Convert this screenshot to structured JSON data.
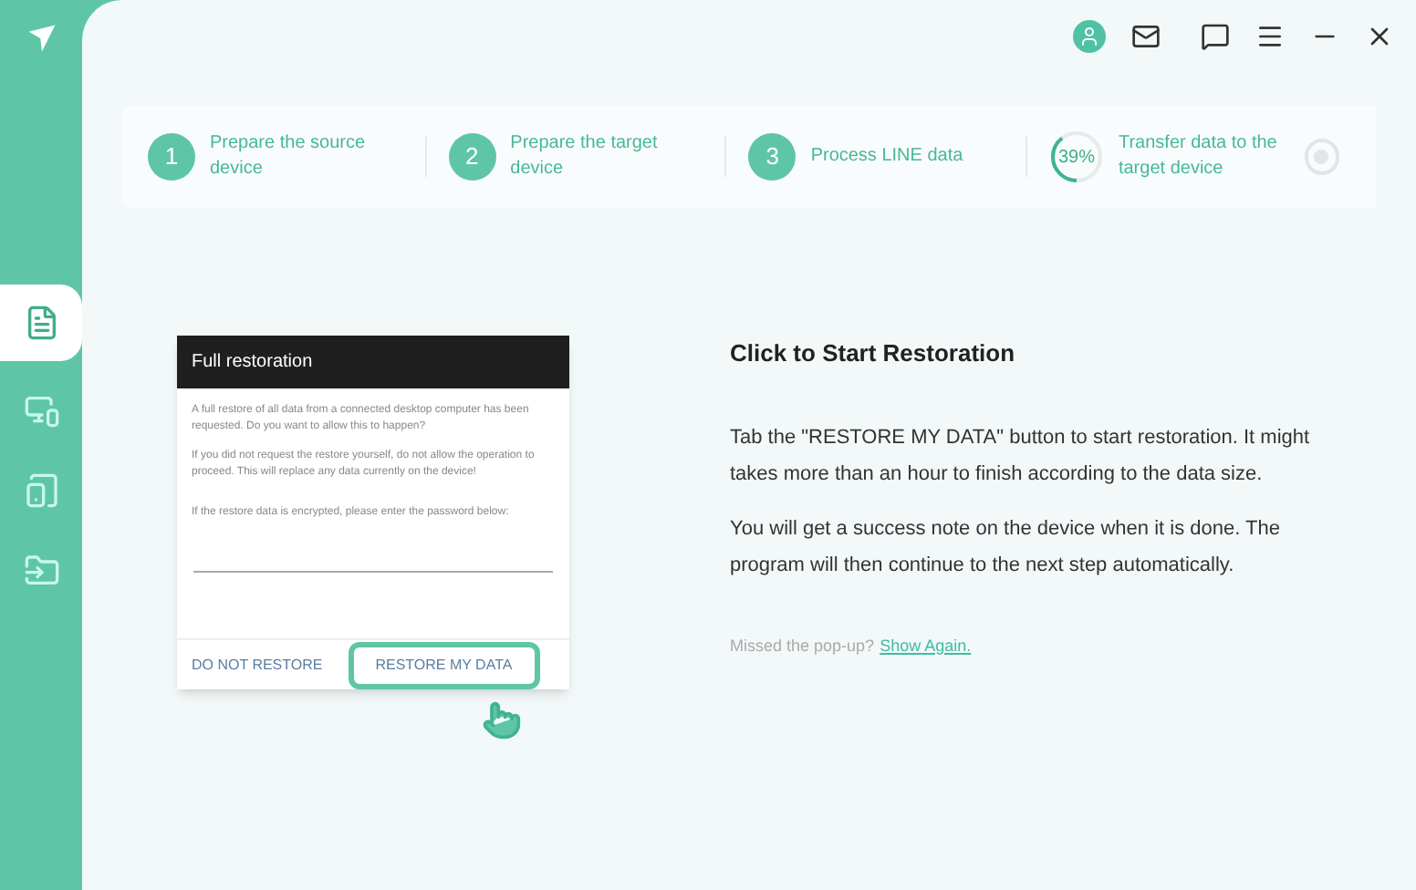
{
  "sidebar": {
    "items": [
      {
        "kind": "document",
        "selected": true
      },
      {
        "kind": "monitor",
        "selected": false
      },
      {
        "kind": "phone",
        "selected": false
      },
      {
        "kind": "folder",
        "selected": false
      }
    ]
  },
  "steps": [
    {
      "kind": "number",
      "number": "1",
      "label": "Prepare the source device"
    },
    {
      "kind": "number",
      "number": "2",
      "label": "Prepare the target device"
    },
    {
      "kind": "number",
      "number": "3",
      "label": "Process LINE data"
    },
    {
      "kind": "progress",
      "number": "39%",
      "label": "Transfer data to the target device"
    }
  ],
  "dialog": {
    "title": "Full restoration",
    "paragraphs": [
      "A full restore of all data from a connected desktop computer has been requested. Do you want to allow this to happen?",
      "If you did not request the restore yourself, do not allow the operation to proceed. This will replace any data currently on the device!",
      "If the restore data is encrypted, please enter the password below:"
    ],
    "buttons": [
      {
        "label": "DO NOT RESTORE",
        "selected": false
      },
      {
        "label": "RESTORE MY DATA",
        "selected": true
      }
    ]
  },
  "instructions": {
    "title": "Click to Start Restoration",
    "paragraphs": [
      "Tab the \"RESTORE MY DATA\" button to start restoration. It might takes more than an hour to finish according to the data size.",
      "You will get a success note on the device when it is done. The program will then continue to the next step automatically."
    ],
    "hint": "Missed the pop-up?",
    "link": "Show Again."
  }
}
